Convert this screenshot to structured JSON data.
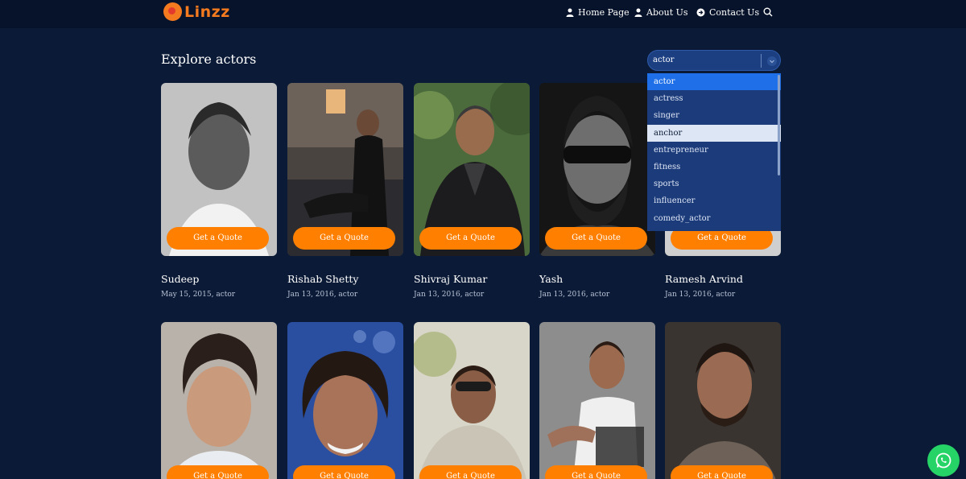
{
  "brand": {
    "name": "Linzz"
  },
  "nav": {
    "home": "Home Page",
    "about": "About Us",
    "contact": "Contact Us"
  },
  "section_title": "Explore actors",
  "filter": {
    "selected": "actor",
    "options": [
      "actor",
      "actress",
      "singer",
      "anchor",
      "entrepreneur",
      "fitness",
      "sports",
      "influencer",
      "comedy_actor"
    ],
    "hovered": "anchor"
  },
  "quote_label": "Get a Quote",
  "row1": [
    {
      "name": "Sudeep",
      "meta": "May 15, 2015, actor"
    },
    {
      "name": "Rishab Shetty",
      "meta": "Jan 13, 2016, actor"
    },
    {
      "name": "Shivraj Kumar",
      "meta": "Jan 13, 2016, actor"
    },
    {
      "name": "Yash",
      "meta": "Jan 13, 2016, actor"
    },
    {
      "name": "Ramesh Arvind",
      "meta": "Jan 13, 2016, actor"
    }
  ],
  "colors": {
    "accent": "#ff7f00",
    "background": "#0b1a36",
    "dropdown": "#1c3b7a",
    "whatsapp": "#25d366"
  }
}
